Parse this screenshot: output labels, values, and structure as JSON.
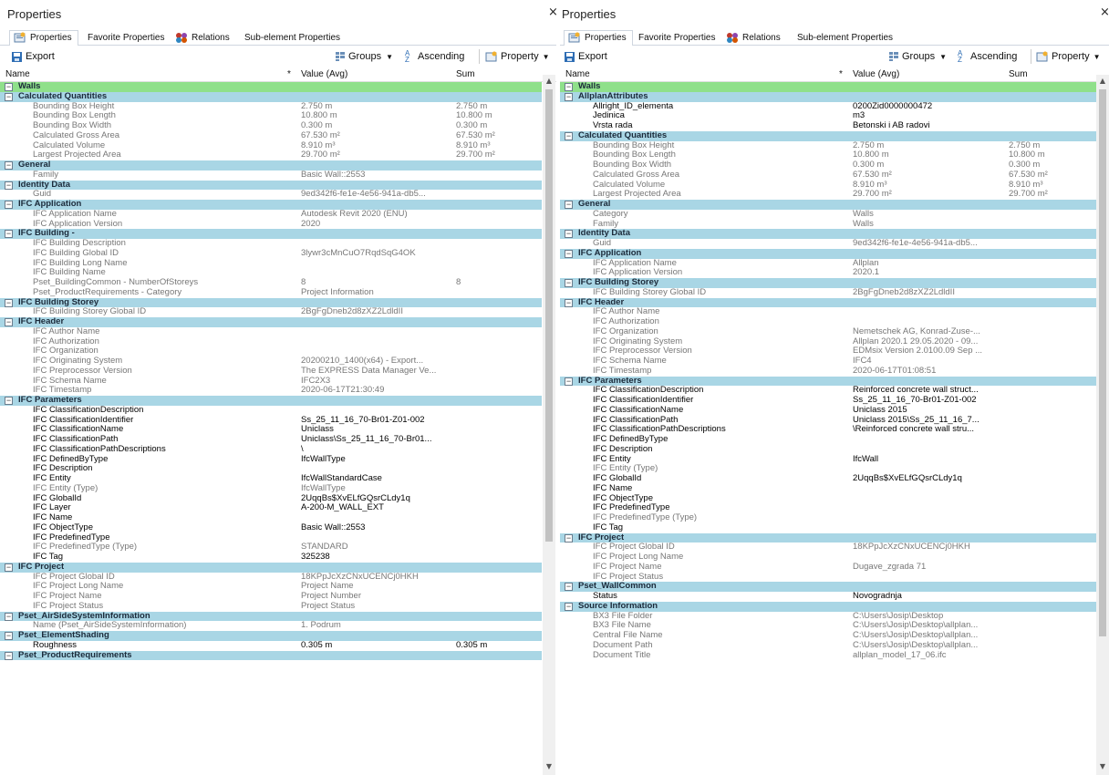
{
  "colors": {
    "category_row": "#a9d6e5",
    "top_row": "#8fe08a",
    "readonly_text": "#777777",
    "editable_text": "#000000"
  },
  "left": {
    "title": "Properties",
    "tabs": [
      "Properties",
      "Favorite Properties",
      "Relations",
      "Sub-element Properties"
    ],
    "toolbar": {
      "export": "Export",
      "groups": "Groups",
      "ascending": "Ascending",
      "property": "Property"
    },
    "headers": {
      "name": "Name",
      "star": "*",
      "value": "Value (Avg)",
      "sum": "Sum"
    },
    "rows": [
      {
        "t": "top",
        "n": "Walls"
      },
      {
        "t": "cat",
        "n": "Calculated Quantities"
      },
      {
        "t": "ro",
        "n": "Bounding Box Height",
        "v": "2.750 m",
        "s": "2.750 m"
      },
      {
        "t": "ro",
        "n": "Bounding Box Length",
        "v": "10.800 m",
        "s": "10.800 m"
      },
      {
        "t": "ro",
        "n": "Bounding Box Width",
        "v": "0.300 m",
        "s": "0.300 m"
      },
      {
        "t": "ro",
        "n": "Calculated Gross Area",
        "v": "67.530 m²",
        "s": "67.530 m²"
      },
      {
        "t": "ro",
        "n": "Calculated Volume",
        "v": "8.910 m³",
        "s": "8.910 m³"
      },
      {
        "t": "ro",
        "n": "Largest Projected Area",
        "v": "29.700 m²",
        "s": "29.700 m²"
      },
      {
        "t": "cat",
        "n": "General"
      },
      {
        "t": "ro",
        "n": "Family",
        "v": "Basic Wall::2553"
      },
      {
        "t": "cat",
        "n": "Identity Data"
      },
      {
        "t": "ro",
        "n": "Guid",
        "v": "9ed342f6-fe1e-4e56-941a-db5..."
      },
      {
        "t": "cat",
        "n": "IFC Application"
      },
      {
        "t": "ro",
        "n": "IFC Application Name",
        "v": "Autodesk Revit 2020 (ENU)"
      },
      {
        "t": "ro",
        "n": "IFC Application Version",
        "v": "2020"
      },
      {
        "t": "cat",
        "n": "IFC Building -"
      },
      {
        "t": "ro",
        "n": "IFC Building Description"
      },
      {
        "t": "ro",
        "n": "IFC Building Global ID",
        "v": "3lywr3cMnCuO7RqdSqG4OK"
      },
      {
        "t": "ro",
        "n": "IFC Building Long Name"
      },
      {
        "t": "ro",
        "n": "IFC Building Name"
      },
      {
        "t": "ro",
        "n": "Pset_BuildingCommon - NumberOfStoreys",
        "v": "8",
        "s": "8"
      },
      {
        "t": "ro",
        "n": "Pset_ProductRequirements - Category",
        "v": "Project Information"
      },
      {
        "t": "cat",
        "n": "IFC Building Storey"
      },
      {
        "t": "ro",
        "n": "IFC Building Storey Global ID",
        "v": "2BgFgDneb2d8zXZ2LdldII"
      },
      {
        "t": "cat",
        "n": "IFC Header"
      },
      {
        "t": "ro",
        "n": "IFC Author Name"
      },
      {
        "t": "ro",
        "n": "IFC Authorization"
      },
      {
        "t": "ro",
        "n": "IFC Organization"
      },
      {
        "t": "ro",
        "n": "IFC Originating System",
        "v": "20200210_1400(x64) - Export..."
      },
      {
        "t": "ro",
        "n": "IFC Preprocessor Version",
        "v": "The EXPRESS Data Manager Ve..."
      },
      {
        "t": "ro",
        "n": "IFC Schema Name",
        "v": "IFC2X3"
      },
      {
        "t": "ro",
        "n": "IFC Timestamp",
        "v": "2020-06-17T21:30:49"
      },
      {
        "t": "cat",
        "n": "IFC Parameters"
      },
      {
        "t": "rw",
        "n": "IFC ClassificationDescription"
      },
      {
        "t": "rw",
        "n": "IFC ClassificationIdentifier",
        "v": "Ss_25_11_16_70-Br01-Z01-002"
      },
      {
        "t": "rw",
        "n": "IFC ClassificationName",
        "v": "Uniclass"
      },
      {
        "t": "rw",
        "n": "IFC ClassificationPath",
        "v": "Uniclass\\Ss_25_11_16_70-Br01..."
      },
      {
        "t": "rw",
        "n": "IFC ClassificationPathDescriptions",
        "v": "\\"
      },
      {
        "t": "rw",
        "n": "IFC DefinedByType",
        "v": "IfcWallType"
      },
      {
        "t": "rw",
        "n": "IFC Description"
      },
      {
        "t": "rw",
        "n": "IFC Entity",
        "v": "IfcWallStandardCase"
      },
      {
        "t": "ro",
        "n": "IFC Entity (Type)",
        "v": "IfcWallType"
      },
      {
        "t": "rw",
        "n": "IFC GlobalId",
        "v": "2UqqBs$XvELfGQsrCLdy1q"
      },
      {
        "t": "rw",
        "n": "IFC Layer",
        "v": "A-200-M_WALL_EXT"
      },
      {
        "t": "rw",
        "n": "IFC Name"
      },
      {
        "t": "rw",
        "n": "IFC ObjectType",
        "v": "Basic Wall::2553"
      },
      {
        "t": "rw",
        "n": "IFC PredefinedType"
      },
      {
        "t": "ro",
        "n": "IFC PredefinedType (Type)",
        "v": "STANDARD"
      },
      {
        "t": "rw",
        "n": "IFC Tag",
        "v": "325238"
      },
      {
        "t": "cat",
        "n": "IFC Project"
      },
      {
        "t": "ro",
        "n": "IFC Project Global ID",
        "v": "18KPpJcXzCNxUCENCj0HKH"
      },
      {
        "t": "ro",
        "n": "IFC Project Long Name",
        "v": "Project Name"
      },
      {
        "t": "ro",
        "n": "IFC Project Name",
        "v": "Project Number"
      },
      {
        "t": "ro",
        "n": "IFC Project Status",
        "v": "Project Status"
      },
      {
        "t": "cat",
        "n": "Pset_AirSideSystemInformation"
      },
      {
        "t": "ro",
        "n": "Name (Pset_AirSideSystemInformation)",
        "v": "1. Podrum"
      },
      {
        "t": "cat",
        "n": "Pset_ElementShading"
      },
      {
        "t": "rw",
        "n": "Roughness",
        "v": "0.305 m",
        "s": "0.305 m"
      },
      {
        "t": "cat",
        "n": "Pset_ProductRequirements"
      }
    ]
  },
  "right": {
    "title": "Properties",
    "tabs": [
      "Properties",
      "Favorite Properties",
      "Relations",
      "Sub-element Properties"
    ],
    "toolbar": {
      "export": "Export",
      "groups": "Groups",
      "ascending": "Ascending",
      "property": "Property"
    },
    "headers": {
      "name": "Name",
      "star": "*",
      "value": "Value (Avg)",
      "sum": "Sum"
    },
    "rows": [
      {
        "t": "top",
        "n": "Walls"
      },
      {
        "t": "cat",
        "n": "AllplanAttributes"
      },
      {
        "t": "rw",
        "n": "Allright_ID_elementa",
        "v": "0200Zid0000000472"
      },
      {
        "t": "rw",
        "n": "Jedinica",
        "v": "m3"
      },
      {
        "t": "rw",
        "n": "Vrsta rada",
        "v": "Betonski i AB radovi"
      },
      {
        "t": "cat",
        "n": "Calculated Quantities"
      },
      {
        "t": "ro",
        "n": "Bounding Box Height",
        "v": "2.750 m",
        "s": "2.750 m"
      },
      {
        "t": "ro",
        "n": "Bounding Box Length",
        "v": "10.800 m",
        "s": "10.800 m"
      },
      {
        "t": "ro",
        "n": "Bounding Box Width",
        "v": "0.300 m",
        "s": "0.300 m"
      },
      {
        "t": "ro",
        "n": "Calculated Gross Area",
        "v": "67.530 m²",
        "s": "67.530 m²"
      },
      {
        "t": "ro",
        "n": "Calculated Volume",
        "v": "8.910 m³",
        "s": "8.910 m³"
      },
      {
        "t": "ro",
        "n": "Largest Projected Area",
        "v": "29.700 m²",
        "s": "29.700 m²"
      },
      {
        "t": "cat",
        "n": "General"
      },
      {
        "t": "ro",
        "n": "Category",
        "v": "Walls"
      },
      {
        "t": "ro",
        "n": "Family",
        "v": "Walls"
      },
      {
        "t": "cat",
        "n": "Identity Data"
      },
      {
        "t": "ro",
        "n": "Guid",
        "v": "9ed342f6-fe1e-4e56-941a-db5..."
      },
      {
        "t": "cat",
        "n": "IFC Application"
      },
      {
        "t": "ro",
        "n": "IFC Application Name",
        "v": "Allplan"
      },
      {
        "t": "ro",
        "n": "IFC Application Version",
        "v": "2020.1"
      },
      {
        "t": "cat",
        "n": "IFC Building Storey"
      },
      {
        "t": "ro",
        "n": "IFC Building Storey Global ID",
        "v": "2BgFgDneb2d8zXZ2LdldII"
      },
      {
        "t": "cat",
        "n": "IFC Header"
      },
      {
        "t": "ro",
        "n": "IFC Author Name"
      },
      {
        "t": "ro",
        "n": "IFC Authorization"
      },
      {
        "t": "ro",
        "n": "IFC Organization",
        "v": "Nemetschek AG, Konrad-Zuse-..."
      },
      {
        "t": "ro",
        "n": "IFC Originating System",
        "v": "Allplan 2020.1 29.05.2020 - 09..."
      },
      {
        "t": "ro",
        "n": "IFC Preprocessor Version",
        "v": "EDMsix Version 2.0100.09 Sep ..."
      },
      {
        "t": "ro",
        "n": "IFC Schema Name",
        "v": "IFC4"
      },
      {
        "t": "ro",
        "n": "IFC Timestamp",
        "v": "2020-06-17T01:08:51"
      },
      {
        "t": "cat",
        "n": "IFC Parameters"
      },
      {
        "t": "rw",
        "n": "IFC ClassificationDescription",
        "v": "Reinforced concrete wall struct..."
      },
      {
        "t": "rw",
        "n": "IFC ClassificationIdentifier",
        "v": "Ss_25_11_16_70-Br01-Z01-002"
      },
      {
        "t": "rw",
        "n": "IFC ClassificationName",
        "v": "Uniclass 2015"
      },
      {
        "t": "rw",
        "n": "IFC ClassificationPath",
        "v": "Uniclass 2015\\Ss_25_11_16_7..."
      },
      {
        "t": "rw",
        "n": "IFC ClassificationPathDescriptions",
        "v": "\\Reinforced concrete wall stru..."
      },
      {
        "t": "rw",
        "n": "IFC DefinedByType"
      },
      {
        "t": "rw",
        "n": "IFC Description"
      },
      {
        "t": "rw",
        "n": "IFC Entity",
        "v": "IfcWall"
      },
      {
        "t": "ro",
        "n": "IFC Entity (Type)"
      },
      {
        "t": "rw",
        "n": "IFC GlobalId",
        "v": "2UqqBs$XvELfGQsrCLdy1q"
      },
      {
        "t": "rw",
        "n": "IFC Name"
      },
      {
        "t": "rw",
        "n": "IFC ObjectType"
      },
      {
        "t": "rw",
        "n": "IFC PredefinedType"
      },
      {
        "t": "ro",
        "n": "IFC PredefinedType (Type)"
      },
      {
        "t": "rw",
        "n": "IFC Tag"
      },
      {
        "t": "cat",
        "n": "IFC Project"
      },
      {
        "t": "ro",
        "n": "IFC Project Global ID",
        "v": "18KPpJcXzCNxUCENCj0HKH"
      },
      {
        "t": "ro",
        "n": "IFC Project Long Name"
      },
      {
        "t": "ro",
        "n": "IFC Project Name",
        "v": "Dugave_zgrada 71"
      },
      {
        "t": "ro",
        "n": "IFC Project Status"
      },
      {
        "t": "cat",
        "n": "Pset_WallCommon"
      },
      {
        "t": "rw",
        "n": "Status",
        "v": "Novogradnja"
      },
      {
        "t": "cat",
        "n": "Source Information"
      },
      {
        "t": "ro",
        "n": "BX3 File Folder",
        "v": "C:\\Users\\Josip\\Desktop"
      },
      {
        "t": "ro",
        "n": "BX3 File Name",
        "v": "C:\\Users\\Josip\\Desktop\\allplan..."
      },
      {
        "t": "ro",
        "n": "Central File Name",
        "v": "C:\\Users\\Josip\\Desktop\\allplan..."
      },
      {
        "t": "ro",
        "n": "Document Path",
        "v": "C:\\Users\\Josip\\Desktop\\allplan..."
      },
      {
        "t": "ro",
        "n": "Document Title",
        "v": "allplan_model_17_06.ifc"
      }
    ]
  }
}
